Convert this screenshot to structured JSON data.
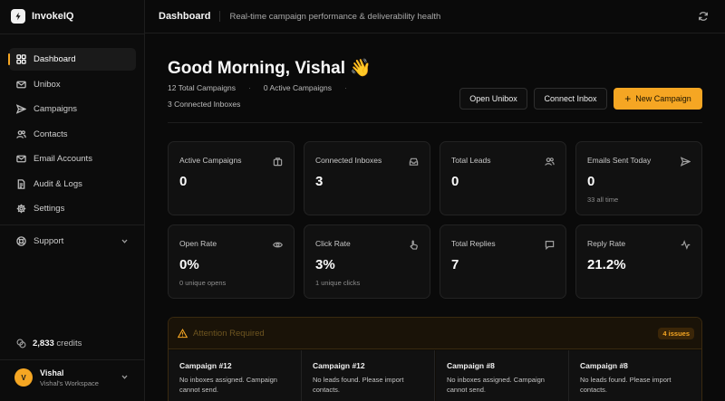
{
  "app": {
    "name": "InvokeIQ"
  },
  "sidebar": {
    "items": [
      {
        "label": "Dashboard",
        "icon": "dashboard-icon",
        "active": true
      },
      {
        "label": "Unibox",
        "icon": "mail-icon"
      },
      {
        "label": "Campaigns",
        "icon": "send-icon"
      },
      {
        "label": "Contacts",
        "icon": "users-icon"
      },
      {
        "label": "Email Accounts",
        "icon": "mail-icon"
      },
      {
        "label": "Audit & Logs",
        "icon": "document-icon"
      },
      {
        "label": "Settings",
        "icon": "gear-icon"
      }
    ],
    "support": {
      "label": "Support",
      "icon": "lifebuoy-icon"
    },
    "credits": {
      "value": "2,833",
      "label": "credits"
    },
    "user": {
      "initial": "V",
      "name": "Vishal",
      "workspace": "Vishal's Workspace"
    }
  },
  "header": {
    "title": "Dashboard",
    "subtitle": "Real-time campaign performance & deliverability health"
  },
  "main": {
    "greeting": "Good Morning, Vishal 👋",
    "stats": {
      "total_campaigns": "12 Total Campaigns",
      "active_campaigns": "0 Active Campaigns",
      "connected_inboxes": "3 Connected Inboxes",
      "separator": "·"
    },
    "buttons": {
      "open_unibox": "Open Unibox",
      "connect_inbox": "Connect Inbox",
      "new_campaign": "New Campaign",
      "new_campaign_icon": "+"
    },
    "cards": [
      {
        "label": "Active Campaigns",
        "value": "0",
        "sub": "",
        "icon": "briefcase-icon"
      },
      {
        "label": "Connected Inboxes",
        "value": "3",
        "sub": "",
        "icon": "inbox-icon"
      },
      {
        "label": "Total Leads",
        "value": "0",
        "sub": "",
        "icon": "users-icon"
      },
      {
        "label": "Emails Sent Today",
        "value": "0",
        "sub": "33 all time",
        "icon": "send-icon"
      },
      {
        "label": "Open Rate",
        "value": "0%",
        "sub": "0 unique opens",
        "icon": "eye-icon"
      },
      {
        "label": "Click Rate",
        "value": "3%",
        "sub": "1 unique clicks",
        "icon": "pointer-icon"
      },
      {
        "label": "Total Replies",
        "value": "7",
        "sub": "",
        "icon": "message-icon"
      },
      {
        "label": "Reply Rate",
        "value": "21.2%",
        "sub": "",
        "icon": "activity-icon"
      }
    ],
    "attention": {
      "title": "Attention Required",
      "badge": "4 issues",
      "issues": [
        {
          "title": "Campaign #12",
          "text": "No inboxes assigned. Campaign cannot send."
        },
        {
          "title": "Campaign #12",
          "text": "No leads found. Please import contacts."
        },
        {
          "title": "Campaign #8",
          "text": "No inboxes assigned. Campaign cannot send."
        },
        {
          "title": "Campaign #8",
          "text": "No leads found. Please import contacts."
        }
      ]
    }
  },
  "colors": {
    "accent": "#f5a623",
    "background": "#0a0a0a",
    "card": "#111111",
    "border": "#232323"
  }
}
